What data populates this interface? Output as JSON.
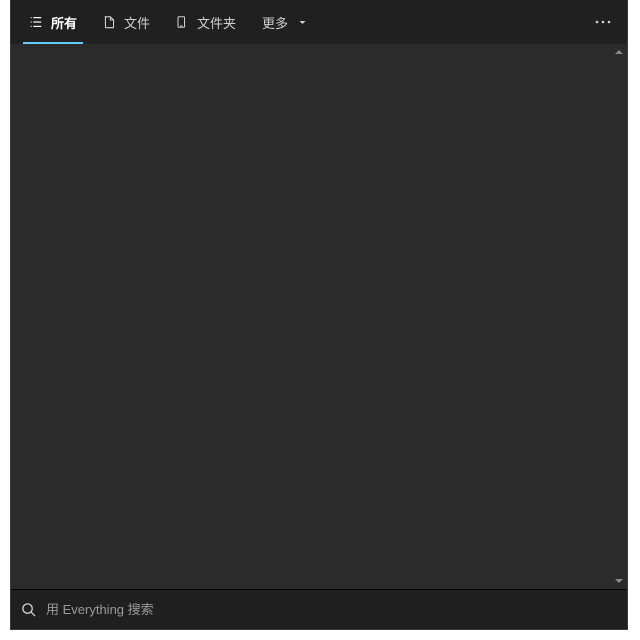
{
  "tabs": {
    "all": {
      "label": "所有",
      "icon": "list-icon",
      "active": true
    },
    "file": {
      "label": "文件",
      "icon": "file-icon",
      "active": false
    },
    "folder": {
      "label": "文件夹",
      "icon": "folder-icon",
      "active": false
    }
  },
  "more": {
    "label": "更多"
  },
  "search": {
    "placeholder": "用 Everything 搜索",
    "value": ""
  },
  "colors": {
    "accent": "#60cdff"
  }
}
